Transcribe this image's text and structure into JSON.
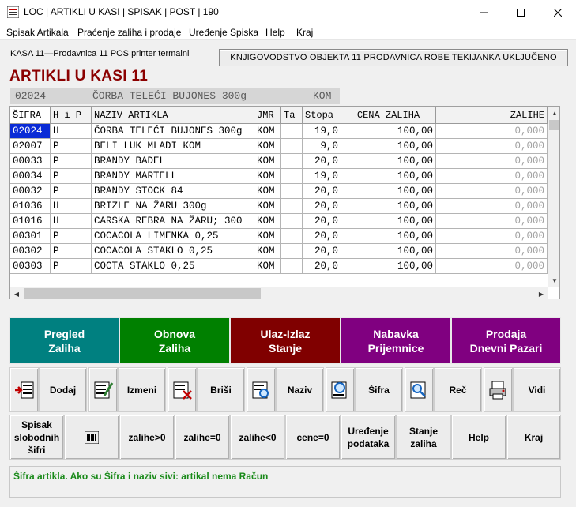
{
  "window": {
    "title": "LOC | ARTIKLI U KASI | SPISAK | POST | 190"
  },
  "menu": [
    "Spisak Artikala",
    "Praćenje zaliha i prodaje",
    "Uređenje Spiska",
    "Help",
    "Kraj"
  ],
  "kasa_label": "KASA 11—Prodavnica 11  POS printer termalni",
  "banner": "KNJIGOVODSTVO OBJEKTA 11 PRODAVNICA ROBE TEKIJANKA UKLJUČENO",
  "heading": "ARTIKLI U KASI 11",
  "selected": {
    "sifra": "02024",
    "naziv": "ČORBA TELEĆI BUJONES 300g",
    "jmr": "KOM"
  },
  "grid": {
    "columns": [
      "ŠIFRA",
      "H i P",
      "NAZIV ARTIKLA",
      "JMR",
      "Ta",
      "Stopa",
      "CENA ZALIHA",
      "ZALIHE"
    ],
    "rows": [
      [
        "02024",
        "H",
        "ČORBA TELEĆI BUJONES 300g",
        "KOM",
        "",
        "19,0",
        "100,00",
        "0,000"
      ],
      [
        "02007",
        "P",
        "BELI LUK MLADI KOM",
        "KOM",
        "",
        "9,0",
        "100,00",
        "0,000"
      ],
      [
        "00033",
        "P",
        "BRANDY BADEL",
        "KOM",
        "",
        "20,0",
        "100,00",
        "0,000"
      ],
      [
        "00034",
        "P",
        "BRANDY MARTELL",
        "KOM",
        "",
        "19,0",
        "100,00",
        "0,000"
      ],
      [
        "00032",
        "P",
        "BRANDY STOCK 84",
        "KOM",
        "",
        "20,0",
        "100,00",
        "0,000"
      ],
      [
        "01036",
        "H",
        "BRIZLE NA ŽARU 300g",
        "KOM",
        "",
        "20,0",
        "100,00",
        "0,000"
      ],
      [
        "01016",
        "H",
        "CARSKA REBRA NA ŽARU; 300",
        "KOM",
        "",
        "20,0",
        "100,00",
        "0,000"
      ],
      [
        "00301",
        "P",
        "COCACOLA LIMENKA 0,25",
        "KOM",
        "",
        "20,0",
        "100,00",
        "0,000"
      ],
      [
        "00302",
        "P",
        "COCACOLA STAKLO 0,25",
        "KOM",
        "",
        "20,0",
        "100,00",
        "0,000"
      ],
      [
        "00303",
        "P",
        "COCTA STAKLO 0,25",
        "KOM",
        "",
        "20,0",
        "100,00",
        "0,000"
      ]
    ]
  },
  "color_buttons": [
    {
      "line1": "Pregled",
      "line2": "Zaliha",
      "color": "#008080"
    },
    {
      "line1": "Obnova",
      "line2": "Zaliha",
      "color": "#008000"
    },
    {
      "line1": "Ulaz-Izlaz",
      "line2": "Stanje",
      "color": "#800000"
    },
    {
      "line1": "Nabavka",
      "line2": "Prijemnice",
      "color": "#800080"
    },
    {
      "line1": "Prodaja",
      "line2": "Dnevni Pazari",
      "color": "#800080"
    }
  ],
  "toolbar1": {
    "dodaj": "Dodaj",
    "izmeni": "Izmeni",
    "brisi": "Briši",
    "naziv": "Naziv",
    "sifra": "Šifra",
    "rec": "Reč",
    "vidi": "Vidi"
  },
  "toolbar2": {
    "spisak": [
      "Spisak",
      "slobodnih",
      "šifri"
    ],
    "zalihe_gt": "zalihe>0",
    "zalihe_eq": "zalihe=0",
    "zalihe_lt": "zalihe<0",
    "cene_eq": "cene=0",
    "uredjenje": [
      "Uređenje",
      "podataka"
    ],
    "stanje": [
      "Stanje",
      "zaliha"
    ],
    "help": "Help",
    "kraj": "Kraj"
  },
  "status": "Šifra artikla. Ako su Šifra i naziv sivi: artikal nema Račun"
}
